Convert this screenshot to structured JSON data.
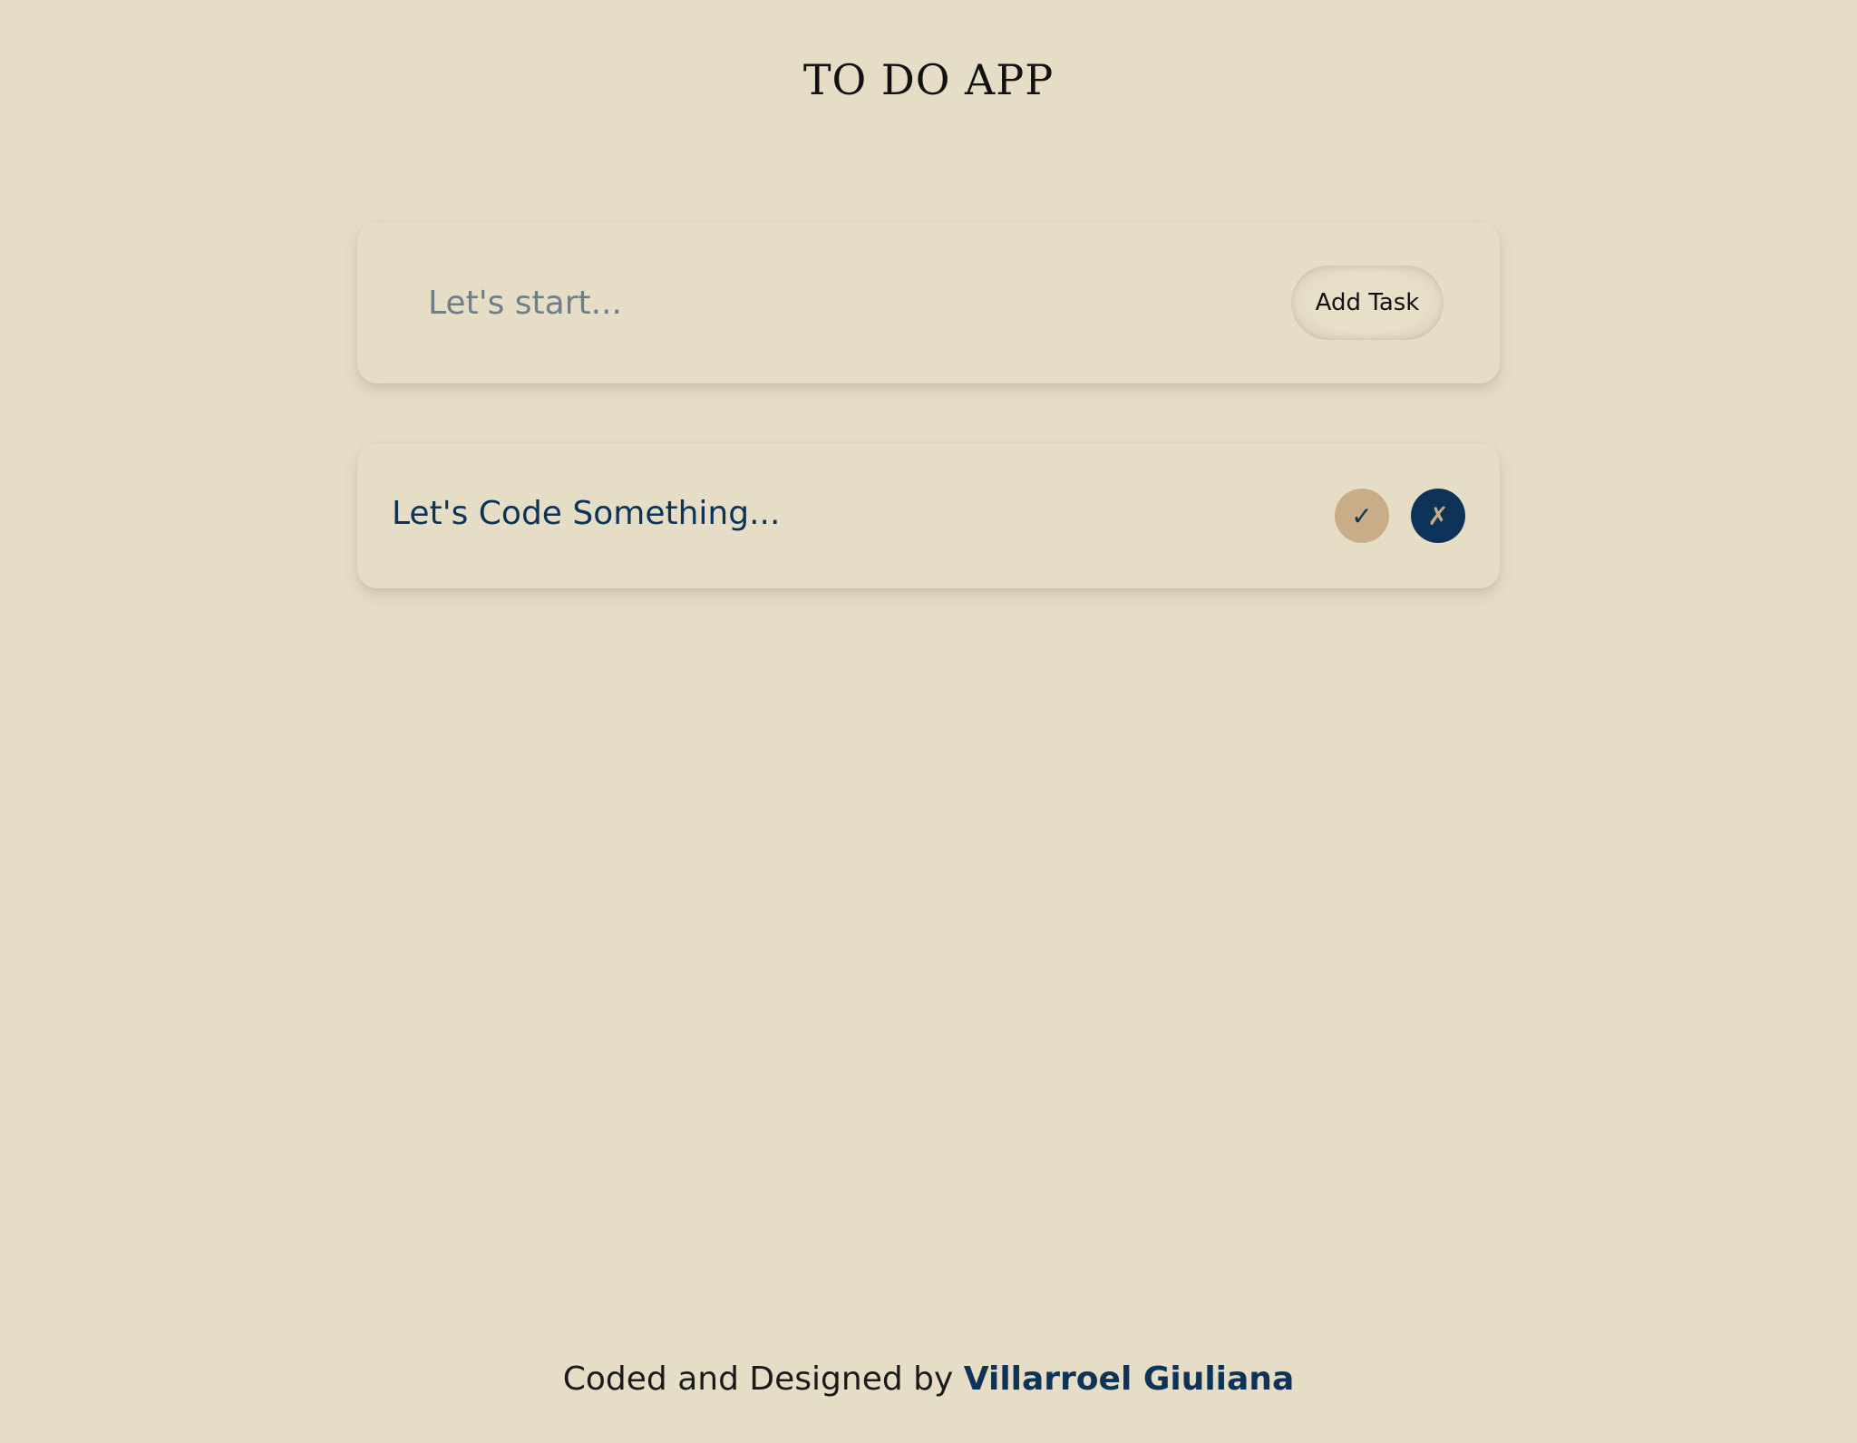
{
  "header": {
    "title": "TO DO APP"
  },
  "input_card": {
    "placeholder": "Let's start...",
    "value": "",
    "add_button_label": "Add Task"
  },
  "tasks": [
    {
      "text": "Let's Code Something...",
      "complete_icon": "check-icon",
      "complete_glyph": "✓",
      "delete_icon": "x-icon",
      "delete_glyph": "✗"
    }
  ],
  "footer": {
    "prefix": "Coded and Designed by",
    "author": "Villarroel Giuliana"
  },
  "colors": {
    "background": "#e6ddc6",
    "navy": "#0d3358",
    "tan": "#c9ad88",
    "placeholder": "#6e7f8a"
  }
}
